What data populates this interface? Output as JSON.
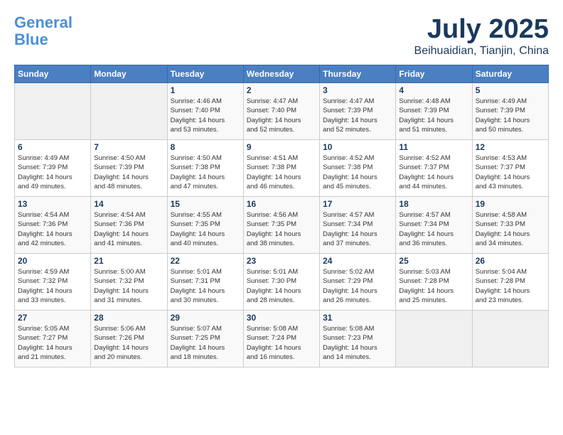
{
  "header": {
    "logo_line1": "General",
    "logo_line2": "Blue",
    "title": "July 2025",
    "subtitle": "Beihuaidian, Tianjin, China"
  },
  "weekdays": [
    "Sunday",
    "Monday",
    "Tuesday",
    "Wednesday",
    "Thursday",
    "Friday",
    "Saturday"
  ],
  "weeks": [
    [
      {
        "day": "",
        "info": ""
      },
      {
        "day": "",
        "info": ""
      },
      {
        "day": "1",
        "info": "Sunrise: 4:46 AM\nSunset: 7:40 PM\nDaylight: 14 hours\nand 53 minutes."
      },
      {
        "day": "2",
        "info": "Sunrise: 4:47 AM\nSunset: 7:40 PM\nDaylight: 14 hours\nand 52 minutes."
      },
      {
        "day": "3",
        "info": "Sunrise: 4:47 AM\nSunset: 7:39 PM\nDaylight: 14 hours\nand 52 minutes."
      },
      {
        "day": "4",
        "info": "Sunrise: 4:48 AM\nSunset: 7:39 PM\nDaylight: 14 hours\nand 51 minutes."
      },
      {
        "day": "5",
        "info": "Sunrise: 4:49 AM\nSunset: 7:39 PM\nDaylight: 14 hours\nand 50 minutes."
      }
    ],
    [
      {
        "day": "6",
        "info": "Sunrise: 4:49 AM\nSunset: 7:39 PM\nDaylight: 14 hours\nand 49 minutes."
      },
      {
        "day": "7",
        "info": "Sunrise: 4:50 AM\nSunset: 7:39 PM\nDaylight: 14 hours\nand 48 minutes."
      },
      {
        "day": "8",
        "info": "Sunrise: 4:50 AM\nSunset: 7:38 PM\nDaylight: 14 hours\nand 47 minutes."
      },
      {
        "day": "9",
        "info": "Sunrise: 4:51 AM\nSunset: 7:38 PM\nDaylight: 14 hours\nand 46 minutes."
      },
      {
        "day": "10",
        "info": "Sunrise: 4:52 AM\nSunset: 7:38 PM\nDaylight: 14 hours\nand 45 minutes."
      },
      {
        "day": "11",
        "info": "Sunrise: 4:52 AM\nSunset: 7:37 PM\nDaylight: 14 hours\nand 44 minutes."
      },
      {
        "day": "12",
        "info": "Sunrise: 4:53 AM\nSunset: 7:37 PM\nDaylight: 14 hours\nand 43 minutes."
      }
    ],
    [
      {
        "day": "13",
        "info": "Sunrise: 4:54 AM\nSunset: 7:36 PM\nDaylight: 14 hours\nand 42 minutes."
      },
      {
        "day": "14",
        "info": "Sunrise: 4:54 AM\nSunset: 7:36 PM\nDaylight: 14 hours\nand 41 minutes."
      },
      {
        "day": "15",
        "info": "Sunrise: 4:55 AM\nSunset: 7:35 PM\nDaylight: 14 hours\nand 40 minutes."
      },
      {
        "day": "16",
        "info": "Sunrise: 4:56 AM\nSunset: 7:35 PM\nDaylight: 14 hours\nand 38 minutes."
      },
      {
        "day": "17",
        "info": "Sunrise: 4:57 AM\nSunset: 7:34 PM\nDaylight: 14 hours\nand 37 minutes."
      },
      {
        "day": "18",
        "info": "Sunrise: 4:57 AM\nSunset: 7:34 PM\nDaylight: 14 hours\nand 36 minutes."
      },
      {
        "day": "19",
        "info": "Sunrise: 4:58 AM\nSunset: 7:33 PM\nDaylight: 14 hours\nand 34 minutes."
      }
    ],
    [
      {
        "day": "20",
        "info": "Sunrise: 4:59 AM\nSunset: 7:32 PM\nDaylight: 14 hours\nand 33 minutes."
      },
      {
        "day": "21",
        "info": "Sunrise: 5:00 AM\nSunset: 7:32 PM\nDaylight: 14 hours\nand 31 minutes."
      },
      {
        "day": "22",
        "info": "Sunrise: 5:01 AM\nSunset: 7:31 PM\nDaylight: 14 hours\nand 30 minutes."
      },
      {
        "day": "23",
        "info": "Sunrise: 5:01 AM\nSunset: 7:30 PM\nDaylight: 14 hours\nand 28 minutes."
      },
      {
        "day": "24",
        "info": "Sunrise: 5:02 AM\nSunset: 7:29 PM\nDaylight: 14 hours\nand 26 minutes."
      },
      {
        "day": "25",
        "info": "Sunrise: 5:03 AM\nSunset: 7:28 PM\nDaylight: 14 hours\nand 25 minutes."
      },
      {
        "day": "26",
        "info": "Sunrise: 5:04 AM\nSunset: 7:28 PM\nDaylight: 14 hours\nand 23 minutes."
      }
    ],
    [
      {
        "day": "27",
        "info": "Sunrise: 5:05 AM\nSunset: 7:27 PM\nDaylight: 14 hours\nand 21 minutes."
      },
      {
        "day": "28",
        "info": "Sunrise: 5:06 AM\nSunset: 7:26 PM\nDaylight: 14 hours\nand 20 minutes."
      },
      {
        "day": "29",
        "info": "Sunrise: 5:07 AM\nSunset: 7:25 PM\nDaylight: 14 hours\nand 18 minutes."
      },
      {
        "day": "30",
        "info": "Sunrise: 5:08 AM\nSunset: 7:24 PM\nDaylight: 14 hours\nand 16 minutes."
      },
      {
        "day": "31",
        "info": "Sunrise: 5:08 AM\nSunset: 7:23 PM\nDaylight: 14 hours\nand 14 minutes."
      },
      {
        "day": "",
        "info": ""
      },
      {
        "day": "",
        "info": ""
      }
    ]
  ]
}
